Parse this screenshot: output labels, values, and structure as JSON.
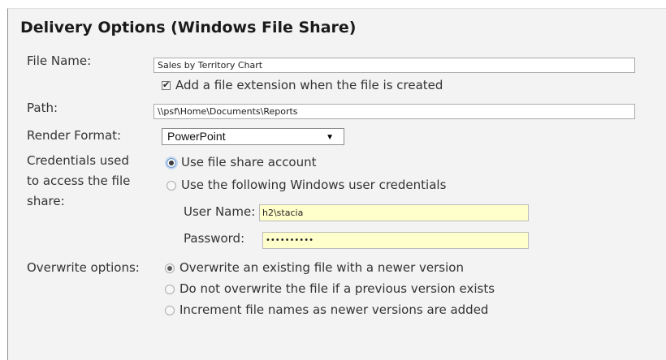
{
  "dialog": {
    "title": "Delivery Options (Windows File Share)"
  },
  "file_name": {
    "label": "File Name:",
    "value": "Sales by Territory Chart"
  },
  "extension_checkbox": {
    "label": "Add a file extension when the file is created",
    "checked": true
  },
  "path": {
    "label": "Path:",
    "value": "\\\\psf\\Home\\Documents\\Reports"
  },
  "render_format": {
    "label": "Render Format:",
    "selected": "PowerPoint",
    "arrow": "▼"
  },
  "credentials": {
    "label_line1": "Credentials used",
    "label_line2": "to access the file",
    "label_line3": "share:",
    "option_share_account": "Use file share account",
    "option_windows_credentials": "Use the following Windows user credentials",
    "selected": "share_account",
    "user_name_label": "User Name:",
    "user_name_value": "h2\\stacia",
    "password_label": "Password:",
    "password_value": "••••••••••"
  },
  "overwrite": {
    "label": "Overwrite options:",
    "option_overwrite": "Overwrite an existing file with a newer version",
    "option_do_not_overwrite": "Do not overwrite the file if a previous version exists",
    "option_increment": "Increment file names as newer versions are added",
    "selected": "overwrite"
  },
  "colors": {
    "panel_background": "#f3f3f3",
    "credential_field_background": "#ffffcc",
    "text": "#333333"
  },
  "icons": {
    "checkbox_mark": "✔",
    "dropdown_arrow": "chevron-down-icon"
  }
}
